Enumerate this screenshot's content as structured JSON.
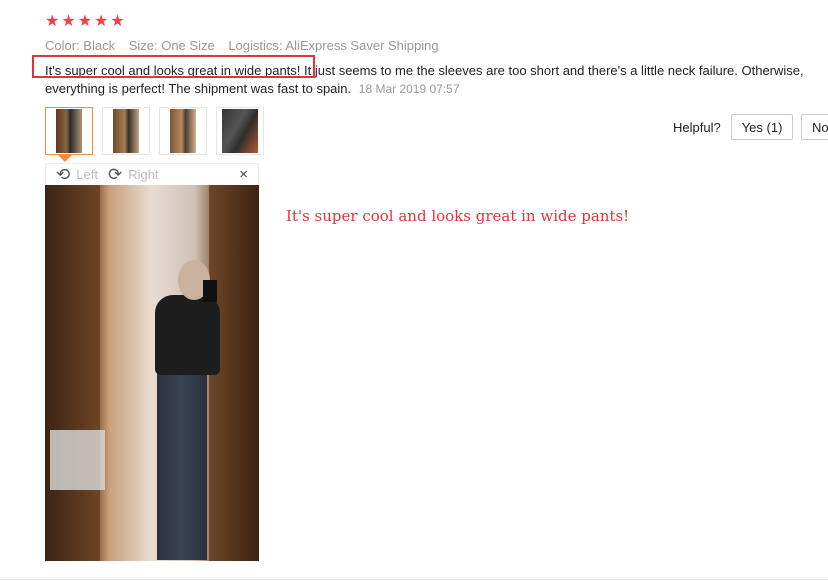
{
  "review": {
    "rating_stars": 5,
    "meta": {
      "color": "Color: Black",
      "size": "Size: One Size",
      "logistics": "Logistics: AliExpress Saver Shipping"
    },
    "text_highlighted": "It's super cool and looks great in wide pants!",
    "text_rest": " It just seems to me the sleeves are too short and there's a little neck failure. Otherwise, everything is perfect! The shipment was fast to spain.",
    "date": "18 Mar 2019 07:57"
  },
  "viewer": {
    "rotate_left": "Left",
    "rotate_right": "Right",
    "close": "×"
  },
  "helpful": {
    "label": "Helpful?",
    "yes": "Yes (1)",
    "no": "No"
  },
  "annotation": {
    "quote": "It's super cool and looks great in wide pants!",
    "color": "#e0343a"
  },
  "colors": {
    "star": "#f0414b",
    "thumb_active_border": "#f08c3a"
  },
  "icons": {
    "star": "star-icon",
    "rotate_left": "rotate-left-icon",
    "rotate_right": "rotate-right-icon",
    "close": "close-icon"
  }
}
